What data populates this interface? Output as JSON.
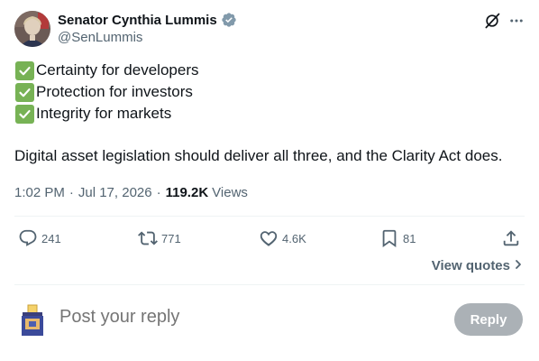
{
  "author": {
    "display_name": "Senator Cynthia Lummis",
    "handle": "@SenLummis",
    "verified": true
  },
  "tweet": {
    "lines": [
      "Certainty for developers",
      "Protection for investors",
      "Integrity for markets"
    ],
    "paragraph": "Digital asset legislation should deliver all three, and the Clarity Act does."
  },
  "meta": {
    "time": "1:02 PM",
    "date": "Jul 17, 2026",
    "views_count": "119.2K",
    "views_label": "Views",
    "separator": "·"
  },
  "actions": {
    "replies": "241",
    "reposts": "771",
    "likes": "4.6K",
    "bookmarks": "81"
  },
  "view_quotes_label": "View quotes",
  "reply": {
    "placeholder": "Post your reply",
    "button_label": "Reply"
  },
  "colors": {
    "text_primary": "#0f1419",
    "text_secondary": "#536471",
    "divider": "#eff3f4",
    "verified_badge": "#829aab",
    "check_green": "#77b255"
  },
  "icons": [
    "avatar",
    "verified-badge-icon",
    "grok-icon",
    "more-icon",
    "check-mark-icon",
    "reply-icon",
    "repost-icon",
    "like-icon",
    "bookmark-icon",
    "share-icon",
    "chevron-right-icon",
    "ballot-box-icon"
  ]
}
